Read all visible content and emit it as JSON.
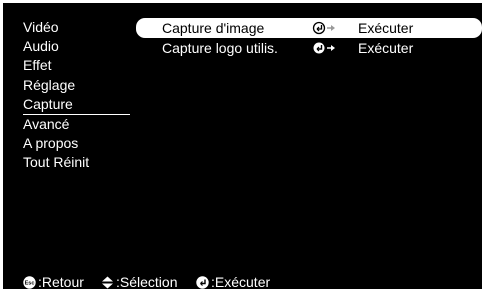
{
  "menu": {
    "items": [
      {
        "label": "Vidéo"
      },
      {
        "label": "Audio"
      },
      {
        "label": "Effet"
      },
      {
        "label": "Réglage"
      },
      {
        "label": "Capture",
        "selected": true
      },
      {
        "label": "Avancé"
      },
      {
        "label": "A propos"
      },
      {
        "label": "Tout Réinit"
      }
    ]
  },
  "submenu": {
    "rows": [
      {
        "label": "Capture d'image",
        "icon": "enter-arrow-icon",
        "action": "Exécuter",
        "highlighted": true
      },
      {
        "label": "Capture logo utilis.",
        "icon": "enter-arrow-icon",
        "action": "Exécuter",
        "highlighted": false
      }
    ]
  },
  "footer": {
    "back_label": ":Retour",
    "back_icon": "esc-icon",
    "select_label": ":Sélection",
    "select_icon": "up-down-arrows-icon",
    "execute_label": ":Exécuter",
    "execute_icon": "enter-icon"
  },
  "colors": {
    "background": "#000000",
    "text": "#ffffff",
    "highlight": "#ffffff"
  }
}
